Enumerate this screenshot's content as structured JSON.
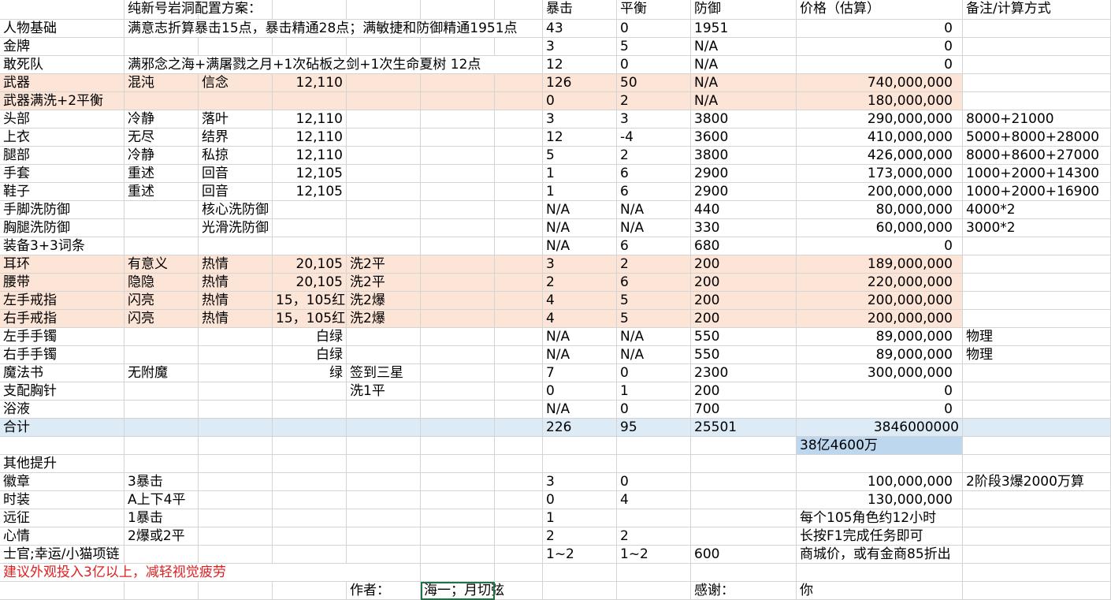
{
  "colors": {
    "peach": "#fce4d6",
    "blue_light": "#ddebf7",
    "blue": "#bdd7ee",
    "grid": "#d4d4d4",
    "red_text": "#e02020",
    "selection": "#217346"
  },
  "rows": [
    {
      "name": "header",
      "cells": [
        "",
        "纯新号岩洞配置方案：",
        "",
        "",
        "",
        "",
        "",
        "暴击",
        "平衡",
        "防御",
        "价格（估算）",
        "备注/计算方式"
      ]
    },
    {
      "name": "base",
      "cells": [
        "人物基础",
        "满意志折算暴击15点，暴击精通28点；满敏捷和防御精通1951点",
        "",
        "",
        "",
        "",
        "",
        "43",
        "0",
        "1951",
        "0",
        ""
      ]
    },
    {
      "name": "medal",
      "cells": [
        "金牌",
        "",
        "",
        "",
        "",
        "",
        "",
        "3",
        "5",
        "N/A",
        "0",
        ""
      ]
    },
    {
      "name": "squad",
      "cells": [
        "敢死队",
        "满邪念之海+满屠戮之月+1次砧板之剑+1次生命夏树 12点",
        "",
        "",
        "",
        "",
        "",
        "12",
        "0",
        "N/A",
        "0",
        ""
      ]
    },
    {
      "name": "weapon",
      "cells": [
        "武器",
        "混沌",
        "信念",
        "12,110",
        "",
        "",
        "",
        "126",
        "50",
        "N/A",
        "740,000,000",
        ""
      ]
    },
    {
      "name": "weapon-wash",
      "cells": [
        "武器满洗+2平衡",
        "",
        "",
        "",
        "",
        "",
        "",
        "0",
        "2",
        "N/A",
        "180,000,000",
        ""
      ]
    },
    {
      "name": "head",
      "cells": [
        "头部",
        "冷静",
        "落叶",
        "12,110",
        "",
        "",
        "",
        "3",
        "3",
        "3800",
        "290,000,000",
        "8000+21000"
      ]
    },
    {
      "name": "top",
      "cells": [
        "上衣",
        "无尽",
        "结界",
        "12,110",
        "",
        "",
        "",
        "12",
        "-4",
        "3600",
        "410,000,000",
        "5000+8000+28000"
      ]
    },
    {
      "name": "legs",
      "cells": [
        "腿部",
        "冷静",
        "私掠",
        "12,110",
        "",
        "",
        "",
        "5",
        "2",
        "3800",
        "426,000,000",
        "8000+8600+27000"
      ]
    },
    {
      "name": "gloves",
      "cells": [
        "手套",
        "重述",
        "回音",
        "12,105",
        "",
        "",
        "",
        "1",
        "6",
        "2900",
        "173,000,000",
        "1000+2000+14300"
      ]
    },
    {
      "name": "shoes",
      "cells": [
        "鞋子",
        "重述",
        "回音",
        "12,105",
        "",
        "",
        "",
        "1",
        "6",
        "2900",
        "200,000,000",
        "1000+2000+16900"
      ]
    },
    {
      "name": "hand-foot-wash",
      "cells": [
        "手脚洗防御",
        "",
        "核心洗防御",
        "",
        "",
        "",
        "",
        "N/A",
        "N/A",
        "440",
        "80,000,000",
        "4000*2"
      ]
    },
    {
      "name": "chest-leg-wash",
      "cells": [
        "胸腿洗防御",
        "",
        "光滑洗防御",
        "",
        "",
        "",
        "",
        "N/A",
        "N/A",
        "330",
        "60,000,000",
        "3000*2"
      ]
    },
    {
      "name": "equip-3-3",
      "cells": [
        "装备3+3词条",
        "",
        "",
        "",
        "",
        "",
        "",
        "N/A",
        "6",
        "680",
        "0",
        ""
      ]
    },
    {
      "name": "earring",
      "cells": [
        "耳环",
        "有意义",
        "热情",
        "20,105",
        "洗2平",
        "",
        "",
        "3",
        "2",
        "200",
        "189,000,000",
        ""
      ]
    },
    {
      "name": "belt",
      "cells": [
        "腰带",
        "隐隐",
        "热情",
        "20,105",
        "洗2平",
        "",
        "",
        "2",
        "6",
        "200",
        "220,000,000",
        ""
      ]
    },
    {
      "name": "ring-left",
      "cells": [
        "左手戒指",
        "闪亮",
        "热情",
        "15，105红",
        "洗2爆",
        "",
        "",
        "4",
        "5",
        "200",
        "200,000,000",
        ""
      ]
    },
    {
      "name": "ring-right",
      "cells": [
        "右手戒指",
        "闪亮",
        "热情",
        "15，105红",
        "洗2爆",
        "",
        "",
        "4",
        "5",
        "200",
        "200,000,000",
        ""
      ]
    },
    {
      "name": "bracelet-left",
      "cells": [
        "左手手镯",
        "",
        "",
        "白绿",
        "",
        "",
        "",
        "N/A",
        "N/A",
        "550",
        "89,000,000",
        "物理"
      ]
    },
    {
      "name": "bracelet-right",
      "cells": [
        "右手手镯",
        "",
        "",
        "白绿",
        "",
        "",
        "",
        "N/A",
        "N/A",
        "550",
        "89,000,000",
        "物理"
      ]
    },
    {
      "name": "magic-book",
      "cells": [
        "魔法书",
        "无附魔",
        "",
        "绿",
        "签到三星",
        "",
        "",
        "7",
        "0",
        "2300",
        "300,000,000",
        ""
      ]
    },
    {
      "name": "brooch",
      "cells": [
        "支配胸针",
        "",
        "",
        "",
        "洗1平",
        "",
        "",
        "0",
        "1",
        "200",
        "0",
        ""
      ]
    },
    {
      "name": "bath",
      "cells": [
        "浴液",
        "",
        "",
        "",
        "",
        "",
        "",
        "N/A",
        "0",
        "700",
        "0",
        ""
      ]
    },
    {
      "name": "total",
      "cells": [
        "合计",
        "",
        "",
        "",
        "",
        "",
        "",
        "226",
        "95",
        "25501",
        "3846000000",
        ""
      ]
    },
    {
      "name": "total-cn",
      "cells": [
        "",
        "",
        "",
        "",
        "",
        "",
        "",
        "",
        "",
        "",
        "38亿4600万",
        ""
      ]
    },
    {
      "name": "other",
      "cells": [
        "其他提升",
        "",
        "",
        "",
        "",
        "",
        "",
        "",
        "",
        "",
        "",
        ""
      ]
    },
    {
      "name": "badge",
      "cells": [
        "徽章",
        "3暴击",
        "",
        "",
        "",
        "",
        "",
        "3",
        "0",
        "",
        "100,000,000",
        "2阶段3爆2000万算"
      ]
    },
    {
      "name": "fashion",
      "cells": [
        "时装",
        "A上下4平",
        "",
        "",
        "",
        "",
        "",
        "0",
        "4",
        "",
        "130,000,000",
        ""
      ]
    },
    {
      "name": "expedition",
      "cells": [
        "远征",
        "1暴击",
        "",
        "",
        "",
        "",
        "",
        "1",
        "",
        "",
        "每个105角色约12小时",
        ""
      ]
    },
    {
      "name": "mood",
      "cells": [
        "心情",
        "2爆或2平",
        "",
        "",
        "",
        "",
        "",
        "2",
        "2",
        "",
        "长按F1完成任务即可",
        ""
      ]
    },
    {
      "name": "officer",
      "cells": [
        "士官;幸运/小猫项链",
        "",
        "",
        "",
        "",
        "",
        "",
        "1~2",
        "1~2",
        "600",
        "商城价，或有金商85折出",
        ""
      ]
    },
    {
      "name": "tip",
      "cells": [
        "建议外观投入3亿以上，减轻视觉疲劳",
        "",
        "",
        "",
        "",
        "",
        "",
        "",
        "",
        "",
        "",
        ""
      ]
    },
    {
      "name": "credits",
      "cells": [
        "",
        "",
        "",
        "",
        "作者：",
        "海一；月切弦",
        "",
        "",
        "",
        "感谢：",
        "你",
        ""
      ]
    }
  ]
}
